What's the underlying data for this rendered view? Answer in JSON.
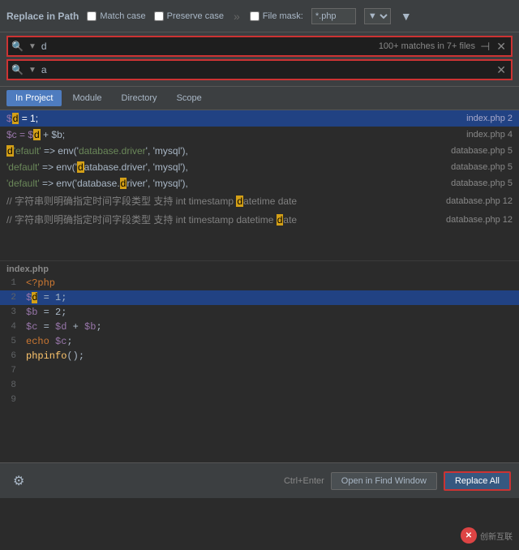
{
  "toolbar": {
    "title": "Replace in Path",
    "match_case_label": "Match case",
    "preserve_case_label": "Preserve case",
    "file_mask_label": "File mask:",
    "file_mask_value": "*.php",
    "filter_icon": "▼",
    "chevron_icon": "»"
  },
  "search": {
    "query": "d",
    "match_count": "100+ matches in 7+ files",
    "replace_value": "a",
    "search_icon": "🔍",
    "clear_icon": "✕",
    "pin_icon": "⊣"
  },
  "tabs": [
    {
      "label": "In Project",
      "active": true
    },
    {
      "label": "Module",
      "active": false
    },
    {
      "label": "Directory",
      "active": false
    },
    {
      "label": "Scope",
      "active": false
    }
  ],
  "results": [
    {
      "id": 1,
      "content": "$d = 1;",
      "file": "index.php 2",
      "selected": true
    },
    {
      "id": 2,
      "content": "$c = $d + $b;",
      "file": "index.php 4",
      "selected": false
    },
    {
      "id": 3,
      "content": "'default'  => env('database.driver', 'mysql'),",
      "file": "database.php 5",
      "selected": false
    },
    {
      "id": 4,
      "content": "'default'  => env('database.driver', 'mysql'),",
      "file": "database.php 5",
      "selected": false
    },
    {
      "id": 5,
      "content": "'default'  => env('database.driver', 'mysql'),",
      "file": "database.php 5",
      "selected": false
    },
    {
      "id": 6,
      "content": "// 字符串则明确指定时间字段类型 支持 int timestamp datetime date",
      "file": "database.php 12",
      "selected": false
    },
    {
      "id": 7,
      "content": "// 字符串则明确指定时间字段类型 支持 int timestamp datetime date",
      "file": "database.php 12",
      "selected": false
    }
  ],
  "file_section": {
    "label": "index.php"
  },
  "code_lines": [
    {
      "num": 1,
      "content": "<?php",
      "type": "keyword"
    },
    {
      "num": 2,
      "content": "$d = 1;",
      "type": "var"
    },
    {
      "num": 3,
      "content": "$b = 2;",
      "type": "var"
    },
    {
      "num": 4,
      "content": "$c = $d + $b;",
      "type": "var"
    },
    {
      "num": 5,
      "content": "echo $c;",
      "type": "normal"
    },
    {
      "num": 6,
      "content": "phpinfo();",
      "type": "normal"
    },
    {
      "num": 7,
      "content": "",
      "type": "empty"
    },
    {
      "num": 8,
      "content": "",
      "type": "empty"
    },
    {
      "num": 9,
      "content": "",
      "type": "empty"
    }
  ],
  "bottom": {
    "settings_icon": "⚙",
    "shortcut": "Ctrl+Enter",
    "open_btn": "Open in Find Window",
    "replace_btn": "Replace All"
  },
  "watermark": {
    "icon": "✕",
    "text": "创新互联"
  }
}
